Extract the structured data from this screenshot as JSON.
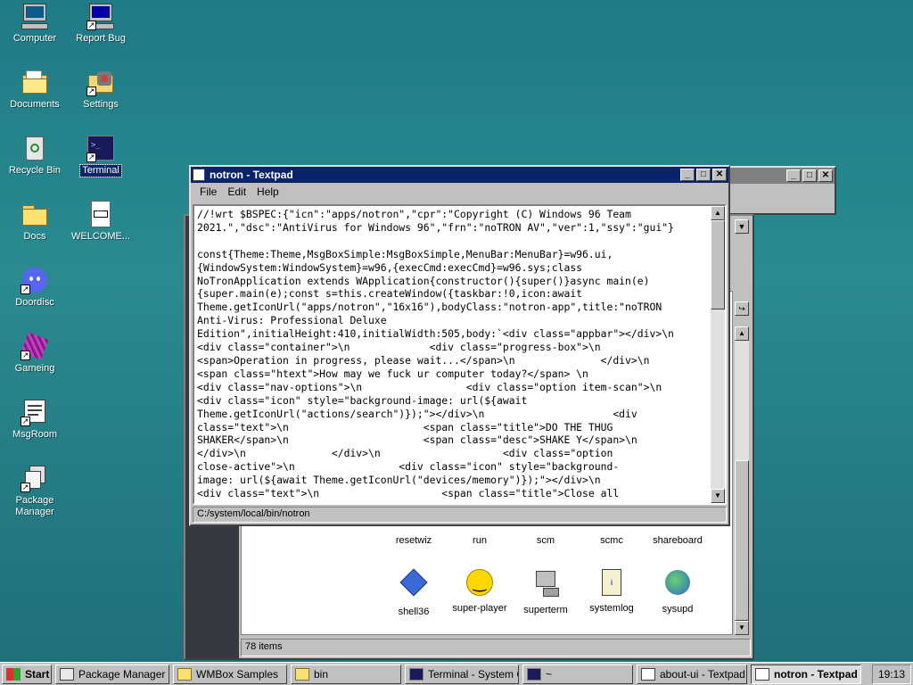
{
  "desktop": {
    "icons": [
      {
        "label": "Computer"
      },
      {
        "label": "Report Bug"
      },
      {
        "label": "Documents"
      },
      {
        "label": "Settings"
      },
      {
        "label": "Recycle Bin"
      },
      {
        "label": "Terminal"
      },
      {
        "label": "Docs"
      },
      {
        "label": "WELCOME..."
      },
      {
        "label": "Doordisc"
      },
      {
        "label": "Gameing"
      },
      {
        "label": "MsgRoom"
      },
      {
        "label": "Package Manager"
      }
    ]
  },
  "textpad": {
    "title": "notron - Textpad",
    "menu": [
      "File",
      "Edit",
      "Help"
    ],
    "status": "C:/system/local/bin/notron",
    "lines": [
      "//!wrt $BSPEC:{\"icn\":\"apps/notron\",\"cpr\":\"Copyright (C) Windows 96 Team",
      "2021.\",\"dsc\":\"AntiVirus for Windows 96\",\"frn\":\"noTRON AV\",\"ver\":1,\"ssy\":\"gui\"}",
      "",
      "const{Theme:Theme,MsgBoxSimple:MsgBoxSimple,MenuBar:MenuBar}=w96.ui,",
      "{WindowSystem:WindowSystem}=w96,{execCmd:execCmd}=w96.sys;class",
      "NoTronApplication extends WApplication{constructor(){super()}async main(e)",
      "{super.main(e);const s=this.createWindow({taskbar:!0,icon:await",
      "Theme.getIconUrl(\"apps/notron\",\"16x16\"),bodyClass:\"notron-app\",title:\"noTRON",
      "Anti-Virus: Professional Deluxe",
      "Edition\",initialHeight:410,initialWidth:505,body:`<div class=\"appbar\"></div>\\n",
      "<div class=\"container\">\\n             <div class=\"progress-box\">\\n",
      "<span>Operation in progress, please wait...</span>\\n              </div>\\n",
      "<span class=\"htext\">How may we fuck ur computer today?</span> \\n",
      "<div class=\"nav-options\">\\n                 <div class=\"option item-scan\">\\n",
      "<div class=\"icon\" style=\"background-image: url(${await",
      "Theme.getIconUrl(\"actions/search\")});\"></div>\\n                     <div",
      "class=\"text\">\\n                      <span class=\"title\">DO THE THUG",
      "SHAKER</span>\\n                      <span class=\"desc\">SHAKE Y</span>\\n",
      "</div>\\n              </div>\\n                    <div class=\"option",
      "close-active\">\\n                 <div class=\"icon\" style=\"background-",
      "image: url(${await Theme.getIconUrl(\"devices/memory\")});\"></div>\\n",
      "<div class=\"text\">\\n                    <span class=\"title\">Close all"
    ]
  },
  "explorer": {
    "status": "78 items",
    "files": [
      {
        "label": "resetwiz"
      },
      {
        "label": "run"
      },
      {
        "label": "scm"
      },
      {
        "label": "scmc"
      },
      {
        "label": "shareboard"
      },
      {
        "label": "shell36"
      },
      {
        "label": "super-player"
      },
      {
        "label": "superterm"
      },
      {
        "label": "systemlog"
      },
      {
        "label": "sysupd"
      }
    ]
  },
  "taskbar": {
    "start": "Start",
    "tasks": [
      {
        "label": "Package Manager"
      },
      {
        "label": "WMBox Samples"
      },
      {
        "label": "bin"
      },
      {
        "label": "Terminal - System C..."
      },
      {
        "label": "~"
      },
      {
        "label": "about-ui - Textpad"
      },
      {
        "label": "notron - Textpad"
      }
    ],
    "clock": "19:13"
  },
  "colors": {
    "titlebar_active": "#0a246a",
    "desktop": "#1f7b86"
  }
}
